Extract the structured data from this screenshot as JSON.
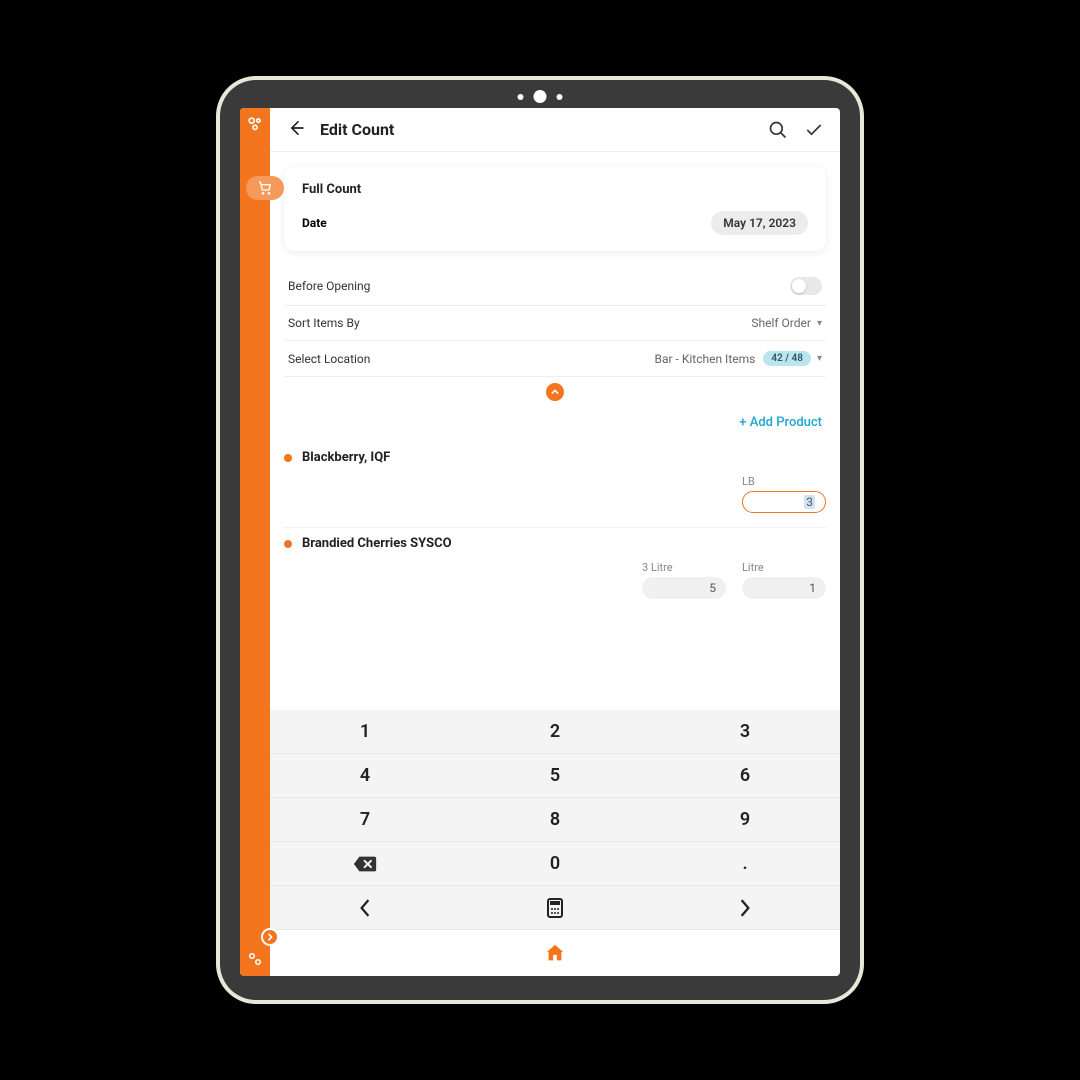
{
  "header": {
    "title": "Edit Count"
  },
  "card": {
    "title": "Full Count",
    "date_label": "Date",
    "date_value": "May 17, 2023"
  },
  "settings": {
    "before_opening_label": "Before Opening",
    "sort_label": "Sort Items By",
    "sort_value": "Shelf Order",
    "location_label": "Select Location",
    "location_value": "Bar - Kitchen Items",
    "count_badge": "42 / 48"
  },
  "add_product_label": "+ Add Product",
  "items": [
    {
      "name": "Blackberry, IQF",
      "units": [
        {
          "label": "LB",
          "value": "3",
          "active": true
        }
      ]
    },
    {
      "name": "Brandied Cherries SYSCO",
      "units": [
        {
          "label": "3 Litre",
          "value": "5",
          "active": false
        },
        {
          "label": "Litre",
          "value": "1",
          "active": false
        }
      ]
    }
  ],
  "keypad": {
    "rows": [
      [
        "1",
        "2",
        "3"
      ],
      [
        "4",
        "5",
        "6"
      ],
      [
        "7",
        "8",
        "9"
      ],
      [
        "bksp",
        "0",
        "."
      ],
      [
        "prev",
        "calc",
        "next"
      ]
    ]
  }
}
